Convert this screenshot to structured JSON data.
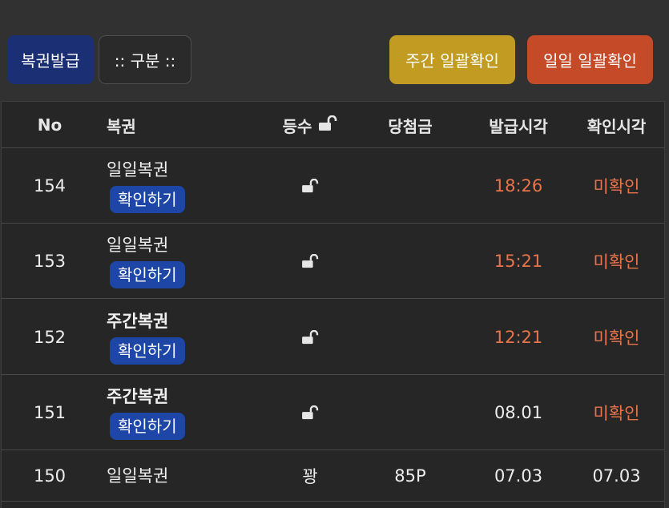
{
  "toolbar": {
    "issue_label": "복권발급",
    "category_label": ":: 구분 ::",
    "weekly_confirm_label": "주간 일괄확인",
    "daily_confirm_label": "일일 일괄확인"
  },
  "colors": {
    "issue_button": "#1b2f74",
    "weekly_button": "#c29c22",
    "daily_button": "#c44a28",
    "check_button": "#1d46a6",
    "unconfirmed_text": "#e8744a"
  },
  "table": {
    "headers": {
      "no": "No",
      "lottery": "복권",
      "rank": "등수",
      "prize": "당첨금",
      "issued_time": "발급시각",
      "confirmed_time": "확인시각"
    },
    "header_icon": "lock-open-icon",
    "check_label": "확인하기",
    "rows": [
      {
        "no": "154",
        "lottery": "일일복권",
        "bold": false,
        "rank_icon": "lock-open-icon",
        "prize": "",
        "issued_time": "18:26",
        "confirmed_time": "미확인"
      },
      {
        "no": "153",
        "lottery": "일일복권",
        "bold": false,
        "rank_icon": "lock-open-icon",
        "prize": "",
        "issued_time": "15:21",
        "confirmed_time": "미확인"
      },
      {
        "no": "152",
        "lottery": "주간복권",
        "bold": true,
        "rank_icon": "lock-open-icon",
        "prize": "",
        "issued_time": "12:21",
        "confirmed_time": "미확인"
      },
      {
        "no": "151",
        "lottery": "주간복권",
        "bold": true,
        "rank_icon": "lock-open-icon",
        "prize": "",
        "issued_time": "08.01",
        "confirmed_time": "미확인"
      },
      {
        "no": "150",
        "lottery": "일일복권",
        "bold": false,
        "rank": "꽝",
        "prize": "85P",
        "issued_time": "07.03",
        "confirmed_time": "07.03"
      }
    ]
  }
}
